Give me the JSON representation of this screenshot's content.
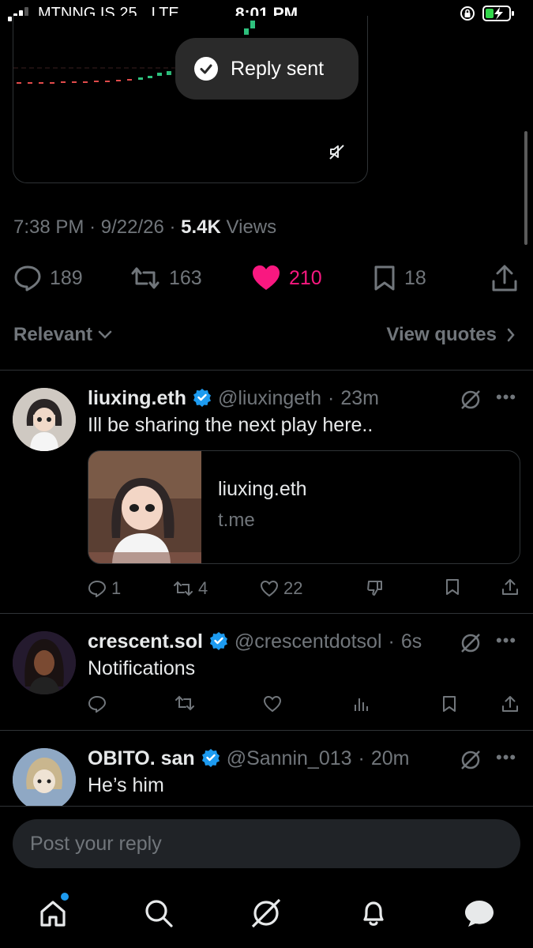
{
  "status_bar": {
    "carrier": "MTNNG IS 25",
    "network": "LTE",
    "time": "8:01 PM"
  },
  "toast": {
    "text": "Reply sent"
  },
  "post_meta": {
    "time": "7:38 PM",
    "date": "9/22/26",
    "views_count": "5.4K",
    "views_label": "Views"
  },
  "post_actions": {
    "replies": "189",
    "reposts": "163",
    "likes": "210",
    "bookmarks": "18"
  },
  "sort": {
    "label": "Relevant",
    "quotes_link": "View quotes"
  },
  "replies": [
    {
      "name": "liuxing.eth",
      "handle": "@liuxingeth",
      "sep": "·",
      "time": "23m",
      "text": "Ill be sharing the next play here..",
      "link_card": {
        "title": "liuxing.eth",
        "domain": "t.me"
      },
      "replies": "1",
      "reposts": "4",
      "likes": "22"
    },
    {
      "name": "crescent.sol",
      "handle": "@crescentdotsol",
      "sep": "·",
      "time": "6s",
      "text": "Notifications"
    },
    {
      "name": "OBITO. san",
      "handle": "@Sannin_013",
      "sep": "·",
      "time": "20m",
      "text": "He’s him"
    }
  ],
  "composer": {
    "placeholder": "Post your reply"
  },
  "colors": {
    "background": "#000000",
    "muted": "#71767b",
    "like_active": "#f91880",
    "verified": "#1d9bf0",
    "divider": "#2f3336"
  }
}
